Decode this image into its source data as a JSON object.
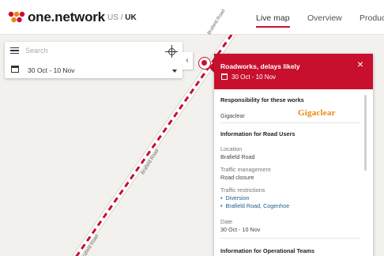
{
  "header": {
    "logo_text": "one.network",
    "region_us": "US",
    "region_separator": "/",
    "region_uk": "UK",
    "nav": [
      "Live map",
      "Overview",
      "Produc"
    ]
  },
  "map": {
    "road_labels": [
      "Brafield Road",
      "Brafield Road",
      "Brafield Road"
    ]
  },
  "search_panel": {
    "search_placeholder": "Search",
    "date_range": "30 Oct - 10 Nov"
  },
  "collapse_tab": "‹",
  "info_panel": {
    "title": "Roadworks, delays likely",
    "date": "30 Oct - 10 Nov",
    "close_symbol": "×",
    "sections": {
      "responsibility_heading": "Responsibility for these works",
      "responsible_org": "Gigaclear",
      "logo_text": "Gigaclear",
      "road_users_heading": "Information for Road Users",
      "location_label": "Location",
      "location_value": "Brafield Road",
      "traffic_mgmt_label": "Traffic management",
      "traffic_mgmt_value": "Road closure",
      "restrictions_label": "Traffic restrictions",
      "restrictions": [
        "Diversion",
        "Brafield Road, Cogenhoe"
      ],
      "date_label": "Date",
      "date_value": "30 Oct - 10 Nov",
      "operational_heading": "Information for Operational Teams"
    }
  },
  "colors": {
    "brand_red": "#c8102e",
    "road_fill": "#ffffff",
    "map_bg": "#f2f1ee",
    "gigaclear_orange": "#e8870f",
    "link_blue": "#1b5e8c"
  }
}
